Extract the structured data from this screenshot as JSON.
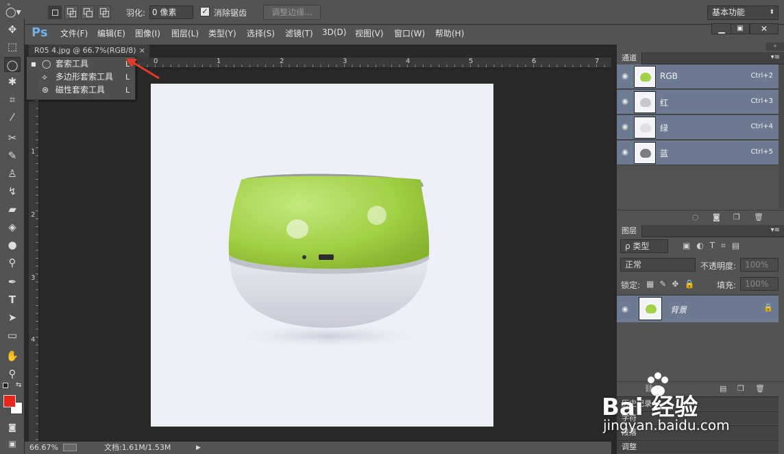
{
  "options_bar": {
    "feather_label": "羽化:",
    "feather_value": "0 像素",
    "antialias_label": "消除锯齿",
    "refine_edge_label": "调整边缘...",
    "workspace": "基本功能"
  },
  "menubar": {
    "logo": "Ps",
    "items": [
      "文件(F)",
      "编辑(E)",
      "图像(I)",
      "图层(L)",
      "类型(Y)",
      "选择(S)",
      "滤镜(T)",
      "3D(D)",
      "视图(V)",
      "窗口(W)",
      "帮助(H)"
    ]
  },
  "document": {
    "tab_title": "R05 4.jpg @ 66.7%(RGB/8)",
    "close": "×",
    "zoom": "66.67%",
    "doc_info": "文档:1.61M/1.53M"
  },
  "rulers": {
    "top": [
      "0",
      "1",
      "2",
      "3",
      "4",
      "5",
      "6",
      "7"
    ],
    "left": [
      "1",
      "2",
      "3",
      "4"
    ]
  },
  "flyout": {
    "items": [
      {
        "label": "套索工具",
        "shortcut": "L"
      },
      {
        "label": "多边形套索工具",
        "shortcut": "L"
      },
      {
        "label": "磁性套索工具",
        "shortcut": "L"
      }
    ]
  },
  "channels_panel": {
    "tab": "通道",
    "channels": [
      {
        "name": "RGB",
        "shortcut": "Ctrl+2"
      },
      {
        "name": "红",
        "shortcut": "Ctrl+3"
      },
      {
        "name": "绿",
        "shortcut": "Ctrl+4"
      },
      {
        "name": "蓝",
        "shortcut": "Ctrl+5"
      }
    ]
  },
  "layers_panel": {
    "tab": "图层",
    "filter": "ρ 类型",
    "blend_mode": "正常",
    "opacity_label": "不透明度:",
    "opacity_value": "100%",
    "lock_label": "锁定:",
    "fill_label": "填充:",
    "fill_value": "100%",
    "layer_name": "背景"
  },
  "collapsed_panels": [
    "历史记录",
    "字符",
    "段落",
    "调整"
  ],
  "watermark": {
    "brand": "Bai 经验",
    "url": "jingyan.baidu.com"
  },
  "colors": {
    "foreground": "#e8251b",
    "background": "#ffffff",
    "arrow": "#e83a2a",
    "selected_row": "#6c7b91"
  }
}
